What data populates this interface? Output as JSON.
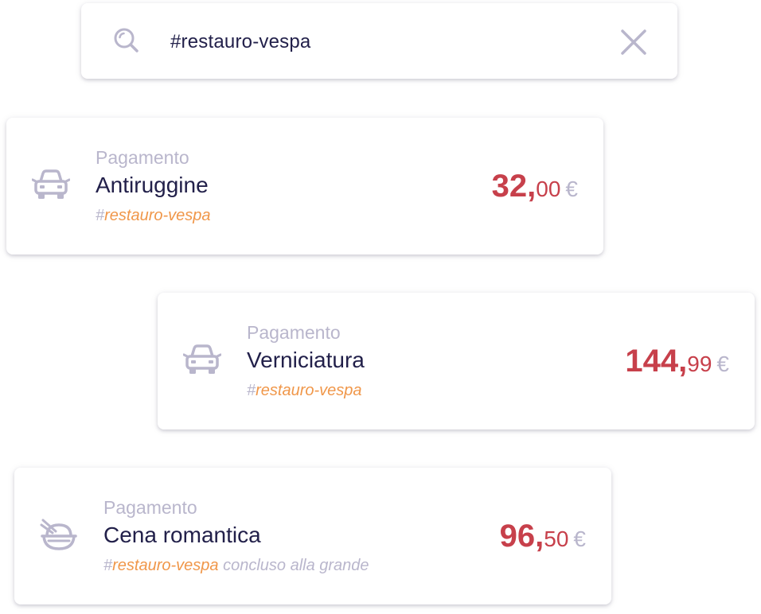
{
  "search": {
    "value": "#restauro-vespa",
    "icon": "search-icon",
    "clear_icon": "close-icon"
  },
  "colors": {
    "text_primary": "#22204a",
    "text_muted": "#b9b6cc",
    "tag": "#f0974a",
    "amount": "#c7404b"
  },
  "transactions": [
    {
      "kind": "Pagamento",
      "title": "Antiruggine",
      "hash": "#",
      "tag": "restauro-vespa",
      "note": "",
      "amount_int": "32",
      "amount_sep": ",",
      "amount_dec": "00",
      "currency": "€",
      "icon": "car-icon"
    },
    {
      "kind": "Pagamento",
      "title": "Verniciatura",
      "hash": "#",
      "tag": "restauro-vespa",
      "note": "",
      "amount_int": "144",
      "amount_sep": ",",
      "amount_dec": "99",
      "currency": "€",
      "icon": "car-icon"
    },
    {
      "kind": "Pagamento",
      "title": "Cena romantica",
      "hash": "#",
      "tag": "restauro-vespa",
      "note": "concluso alla grande",
      "amount_int": "96",
      "amount_sep": ",",
      "amount_dec": "50",
      "currency": "€",
      "icon": "food-bowl-icon"
    }
  ]
}
